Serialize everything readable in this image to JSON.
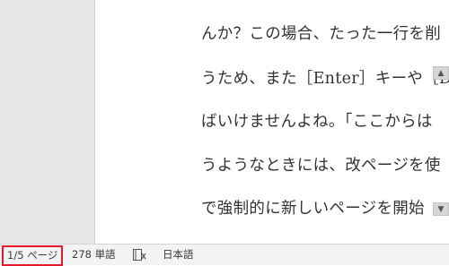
{
  "document": {
    "lines": [
      "んか？この場合、たった一行を削",
      "うため、また［Enter］キーや［D",
      "ばいけませんよね。「ここからは",
      "うようなときには、改ページを使",
      "で強制的に新しいページを開始"
    ]
  },
  "status_bar": {
    "page_count": "1/5 ページ",
    "word_count": "278 単語",
    "proofing_icon": "proofing-book-icon",
    "language": "日本語"
  },
  "colors": {
    "highlight_box": "#e8172a",
    "workspace_bg": "#e6e6e6",
    "status_bar_bg": "#f3f3f3"
  }
}
